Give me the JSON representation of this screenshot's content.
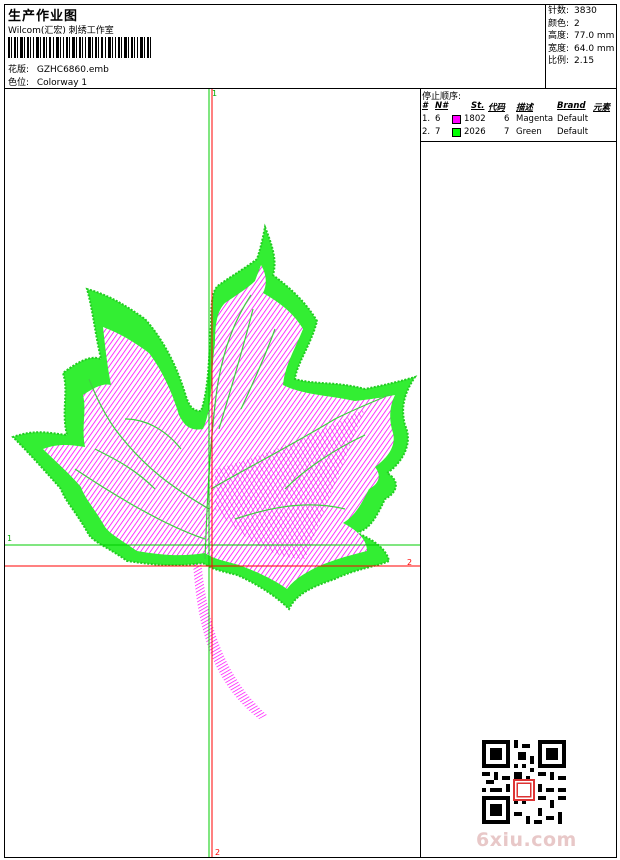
{
  "header": {
    "title": "生产作业图",
    "company": "Wilcom(汇宏) 刺绣工作室",
    "design_label": "花版:",
    "design_value": "GZHC6860.emb",
    "colorway_label": "色位:",
    "colorway_value": "Colorway 1"
  },
  "stats": [
    {
      "label": "针数:",
      "value": "3830"
    },
    {
      "label": "颜色:",
      "value": "2"
    },
    {
      "label": "高度:",
      "value": "77.0 mm"
    },
    {
      "label": "宽度:",
      "value": "64.0 mm"
    },
    {
      "label": "比例:",
      "value": "2.15"
    }
  ],
  "stop_sequence": {
    "title": "停止顺序:",
    "headers": [
      "#",
      "N#",
      "St.",
      "代码",
      "描述",
      "Brand",
      "元素"
    ],
    "rows": [
      {
        "idx": "1.",
        "n": "6",
        "stitches": "1802",
        "code": "6",
        "desc": "Magenta",
        "brand": "Default",
        "color": "#ff00ff"
      },
      {
        "idx": "2.",
        "n": "7",
        "stitches": "2026",
        "code": "7",
        "desc": "Green",
        "brand": "Default",
        "color": "#00ff00"
      }
    ]
  },
  "canvas": {
    "marker_v_green": "1",
    "marker_h_green": "1",
    "marker_v_red": "2",
    "marker_h_red": "2",
    "accent_green": "#00cc00",
    "accent_red": "#ff0000",
    "thread_magenta": "#ff00ff",
    "thread_green": "#33ee33"
  },
  "watermark": "6xiu.com"
}
